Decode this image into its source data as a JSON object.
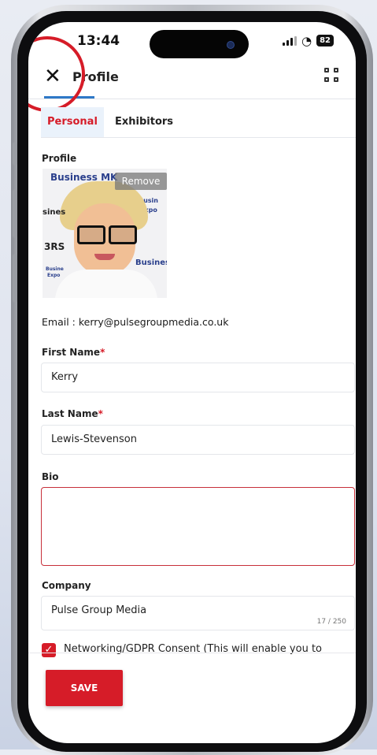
{
  "status_bar": {
    "time": "13:44",
    "battery": "82"
  },
  "appbar": {
    "title": "Profile",
    "close_icon": "close-icon",
    "scan_icon": "qr-scan-icon"
  },
  "tabs": [
    {
      "label": "Personal",
      "active": true
    },
    {
      "label": "Exhibitors",
      "active": false
    }
  ],
  "profile": {
    "label": "Profile",
    "remove_label": "Remove",
    "photo_backdrop": [
      "Business MK",
      "Busin",
      "Expo",
      "3RS",
      "Business",
      "Busine",
      "Expo",
      "sines"
    ]
  },
  "email_line": "Email : kerry@pulsegroupmedia.co.uk",
  "form": {
    "first_name": {
      "label": "First Name",
      "required": "*",
      "value": "Kerry"
    },
    "last_name": {
      "label": "Last Name",
      "required": "*",
      "value": "Lewis-Stevenson"
    },
    "bio": {
      "label": "Bio",
      "value": ""
    },
    "company": {
      "label": "Company",
      "value": "Pulse Group Media",
      "counter": "17 / 250"
    }
  },
  "consent": {
    "checked": true,
    "text": "Networking/GDPR Consent (This will enable you to"
  },
  "save_label": "SAVE",
  "colors": {
    "accent": "#d61c28",
    "tab_bg": "#eaf2fb",
    "indicator": "#2e79c7"
  }
}
